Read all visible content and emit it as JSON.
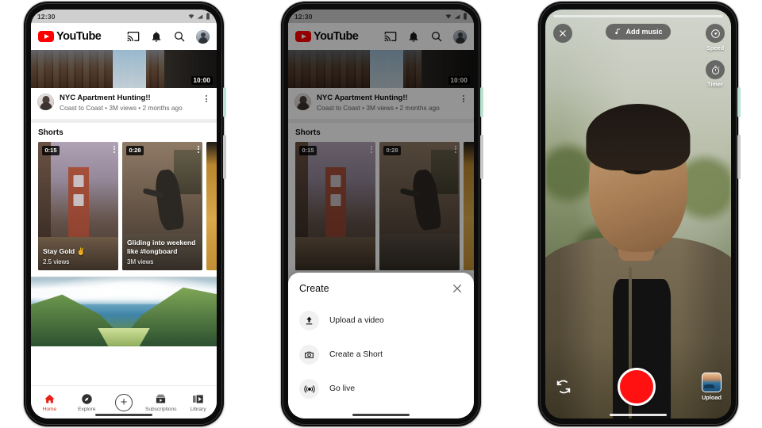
{
  "phones": [
    {
      "id": "phone-home",
      "status_bar": {
        "time": "12:30",
        "icons": [
          "wifi-icon",
          "signal-icon",
          "battery-icon"
        ]
      },
      "header": {
        "logo_text": "YouTube",
        "brand_color": "#ff0000",
        "actions": [
          "cast-icon",
          "bell-icon",
          "search-icon",
          "account-avatar"
        ]
      },
      "video": {
        "duration": "10:00",
        "title": "NYC Apartment Hunting!!",
        "meta": "Coast to Coast • 3M views • 2 months ago",
        "channel_avatar": "channel-avatar",
        "menu": "kebab-menu-icon"
      },
      "shorts": {
        "section_title": "Shorts",
        "cards": [
          {
            "duration": "0:15",
            "title": "Stay Gold ✌",
            "views": "2.5 views"
          },
          {
            "duration": "0:28",
            "title": "Gliding into weekend like #longboard",
            "views": "3M views"
          }
        ]
      },
      "bottom_nav": {
        "items": [
          {
            "label": "Home",
            "icon": "home-icon",
            "active": true
          },
          {
            "label": "Explore",
            "icon": "compass-icon",
            "active": false
          },
          {
            "label": "",
            "icon": "plus-circle-icon",
            "active": false
          },
          {
            "label": "Subscriptions",
            "icon": "subscriptions-icon",
            "active": false
          },
          {
            "label": "Library",
            "icon": "library-icon",
            "active": false
          }
        ],
        "active_color": "#d93025"
      }
    },
    {
      "id": "phone-create-sheet",
      "status_bar": {
        "time": "12:30"
      },
      "header": {
        "logo_text": "YouTube"
      },
      "video": {
        "duration": "10:00",
        "title": "NYC Apartment Hunting!!",
        "meta": "Coast to Coast • 3M views • 2 months ago"
      },
      "shorts": {
        "section_title": "Shorts",
        "cards": [
          {
            "duration": "0:15"
          },
          {
            "duration": "0:28"
          }
        ]
      },
      "sheet": {
        "title": "Create",
        "close": "close-icon",
        "items": [
          {
            "label": "Upload a video",
            "icon": "upload-icon"
          },
          {
            "label": "Create a Short",
            "icon": "camera-icon"
          },
          {
            "label": "Go live",
            "icon": "broadcast-icon"
          }
        ]
      }
    },
    {
      "id": "phone-shorts-camera",
      "top": {
        "close": "close-icon",
        "add_music_label": "Add music",
        "music_icon": "music-note-icon"
      },
      "side_tools": [
        {
          "label": "Speed",
          "icon": "speedometer-icon"
        },
        {
          "label": "Timer",
          "icon": "timer-icon"
        }
      ],
      "bottom": {
        "flip_icon": "camera-flip-icon",
        "record_button": "record-button",
        "record_color": "#ff1111",
        "upload_label": "Upload",
        "upload_icon": "gallery-thumbnail"
      }
    }
  ]
}
